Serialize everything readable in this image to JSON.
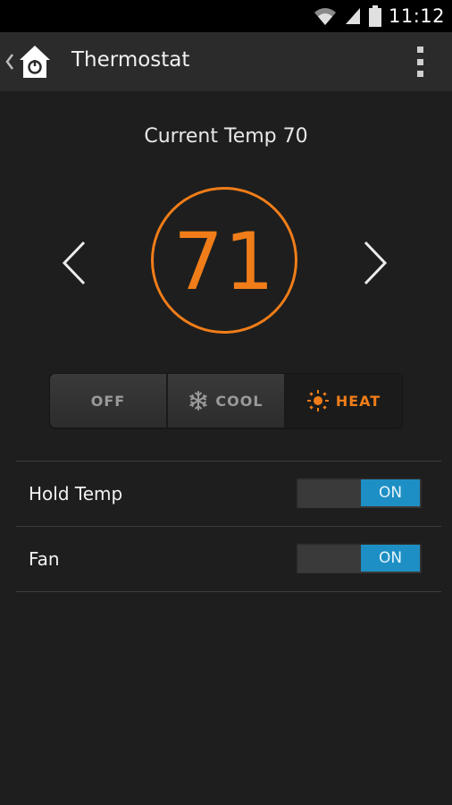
{
  "status_bar": {
    "time": "11:12",
    "icons": [
      "wifi-icon",
      "signal-icon",
      "battery-icon"
    ]
  },
  "action_bar": {
    "title": "Thermostat",
    "app_icon": "home-power-icon",
    "up_icon": "chevron-left-icon",
    "menu_icon": "overflow-menu-icon"
  },
  "thermostat": {
    "current_temp_label": "Current Temp 70",
    "setpoint": "71",
    "decrease_icon": "chevron-left-icon",
    "increase_icon": "chevron-right-icon",
    "accent_color": "#f07d19"
  },
  "modes": [
    {
      "label": "OFF",
      "icon": "",
      "active": false
    },
    {
      "label": "COOL",
      "icon": "snowflake-icon",
      "active": false
    },
    {
      "label": "HEAT",
      "icon": "sun-icon",
      "active": true
    }
  ],
  "settings": [
    {
      "label": "Hold Temp",
      "toggle_state": "ON"
    },
    {
      "label": "Fan",
      "toggle_state": "ON"
    }
  ],
  "colors": {
    "background": "#1e1e1e",
    "action_bar": "#2b2b2b",
    "toggle_on": "#1e8fc4"
  }
}
